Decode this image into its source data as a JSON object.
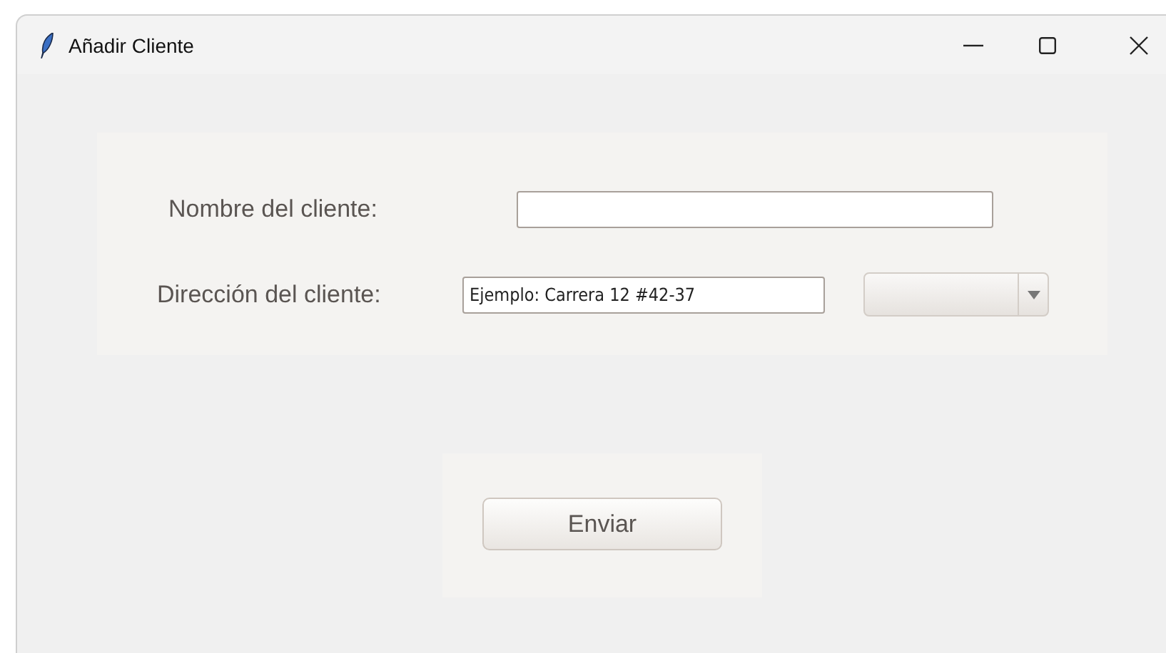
{
  "window": {
    "title": "Añadir Cliente"
  },
  "form": {
    "fields": [
      {
        "label": "Nombre del cliente:"
      },
      {
        "label": "Dirección del cliente:",
        "value": "Ejemplo: Carrera 12 #42-37"
      }
    ]
  },
  "buttons": [
    {
      "label": "Enviar"
    }
  ]
}
